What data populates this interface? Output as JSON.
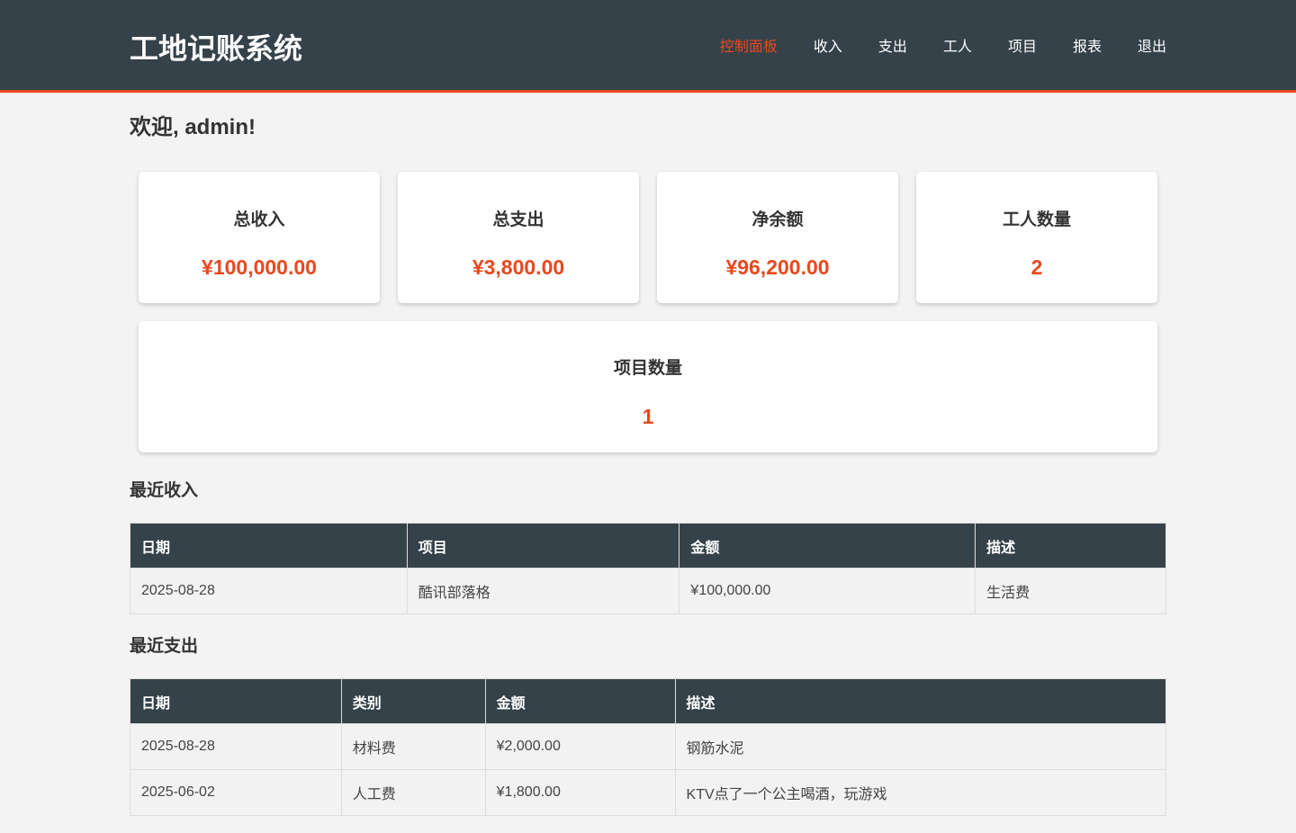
{
  "app": {
    "title": "工地记账系统"
  },
  "nav": {
    "items": [
      {
        "label": "控制面板",
        "active": true
      },
      {
        "label": "收入"
      },
      {
        "label": "支出"
      },
      {
        "label": "工人"
      },
      {
        "label": "项目"
      },
      {
        "label": "报表"
      },
      {
        "label": "退出"
      }
    ]
  },
  "welcome": "欢迎, admin!",
  "stats": [
    {
      "label": "总收入",
      "value": "¥100,000.00"
    },
    {
      "label": "总支出",
      "value": "¥3,800.00"
    },
    {
      "label": "净余额",
      "value": "¥96,200.00"
    },
    {
      "label": "工人数量",
      "value": "2"
    },
    {
      "label": "项目数量",
      "value": "1"
    }
  ],
  "recent_income": {
    "title": "最近收入",
    "headers": [
      "日期",
      "项目",
      "金额",
      "描述"
    ],
    "rows": [
      [
        "2025-08-28",
        "酷讯部落格",
        "¥100,000.00",
        "生活费"
      ]
    ]
  },
  "recent_expense": {
    "title": "最近支出",
    "headers": [
      "日期",
      "类别",
      "金额",
      "描述"
    ],
    "rows": [
      [
        "2025-08-28",
        "材料费",
        "¥2,000.00",
        "钢筋水泥"
      ],
      [
        "2025-06-02",
        "人工费",
        "¥1,800.00",
        "KTV点了一个公主喝酒，玩游戏"
      ]
    ]
  },
  "colors": {
    "header_bg": "#35424a",
    "accent": "#e8491d",
    "page_bg": "#f3f3f3"
  }
}
